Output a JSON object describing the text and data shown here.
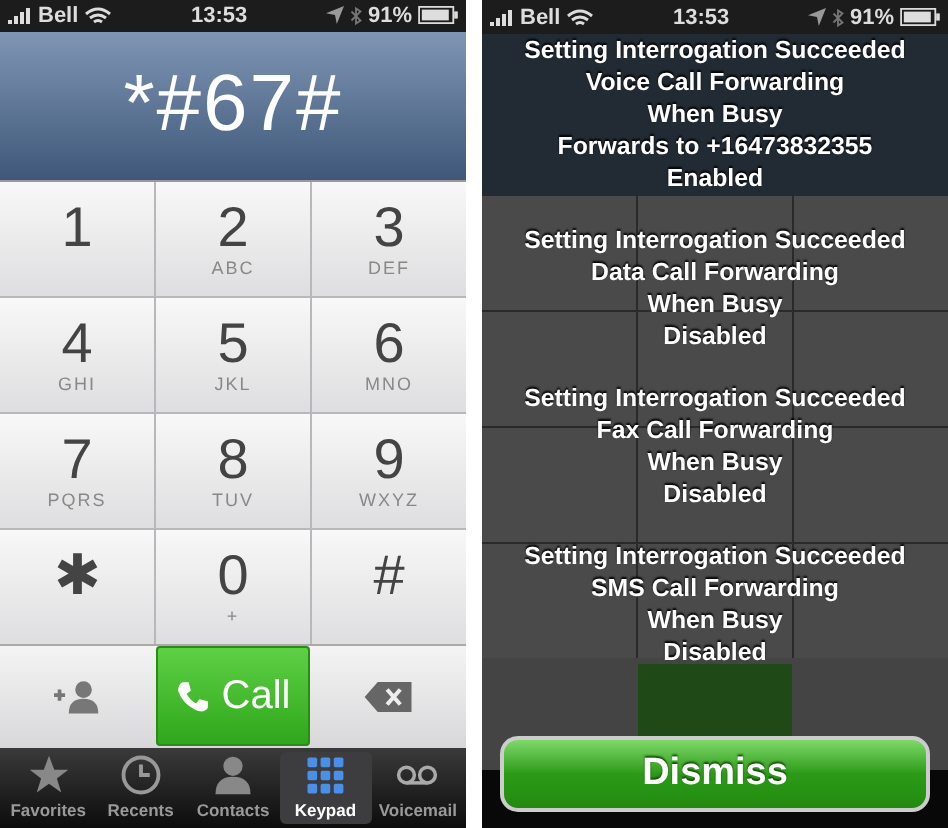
{
  "dialer": {
    "status_bar": {
      "carrier": "Bell",
      "time": "13:53",
      "battery": "91%"
    },
    "display": "*#67#",
    "keys": [
      {
        "digit": "1"
      },
      {
        "digit": "2",
        "letters": "ABC"
      },
      {
        "digit": "3",
        "letters": "DEF"
      },
      {
        "digit": "4",
        "letters": "GHI"
      },
      {
        "digit": "5",
        "letters": "JKL"
      },
      {
        "digit": "6",
        "letters": "MNO"
      },
      {
        "digit": "7",
        "letters": "PQRS"
      },
      {
        "digit": "8",
        "letters": "TUV"
      },
      {
        "digit": "9",
        "letters": "WXYZ"
      },
      {
        "digit": "✱"
      },
      {
        "digit": "0",
        "letters": "+"
      },
      {
        "digit": "#"
      }
    ],
    "call_button": "Call",
    "tab_bar": [
      {
        "label": "Favorites",
        "selected": false
      },
      {
        "label": "Recents",
        "selected": false
      },
      {
        "label": "Contacts",
        "selected": false
      },
      {
        "label": "Keypad",
        "selected": true
      },
      {
        "label": "Voicemail",
        "selected": false
      }
    ]
  },
  "alert_screen": {
    "status_bar": {
      "carrier": "Bell",
      "time": "13:53",
      "battery": "91%"
    },
    "messages": [
      {
        "lines": [
          "Setting Interrogation Succeeded",
          "Voice Call Forwarding",
          "When Busy",
          "Forwards to +16473832355",
          "Enabled"
        ]
      },
      {
        "lines": [
          "Setting Interrogation Succeeded",
          "Data Call Forwarding",
          "When Busy",
          "Disabled"
        ]
      },
      {
        "lines": [
          "Setting Interrogation Succeeded",
          "Fax Call Forwarding",
          "When Busy",
          "Disabled"
        ]
      },
      {
        "lines": [
          "Setting Interrogation Succeeded",
          "SMS Call Forwarding",
          "When Busy",
          "Disabled"
        ]
      }
    ],
    "dismiss_button": "Dismiss"
  }
}
